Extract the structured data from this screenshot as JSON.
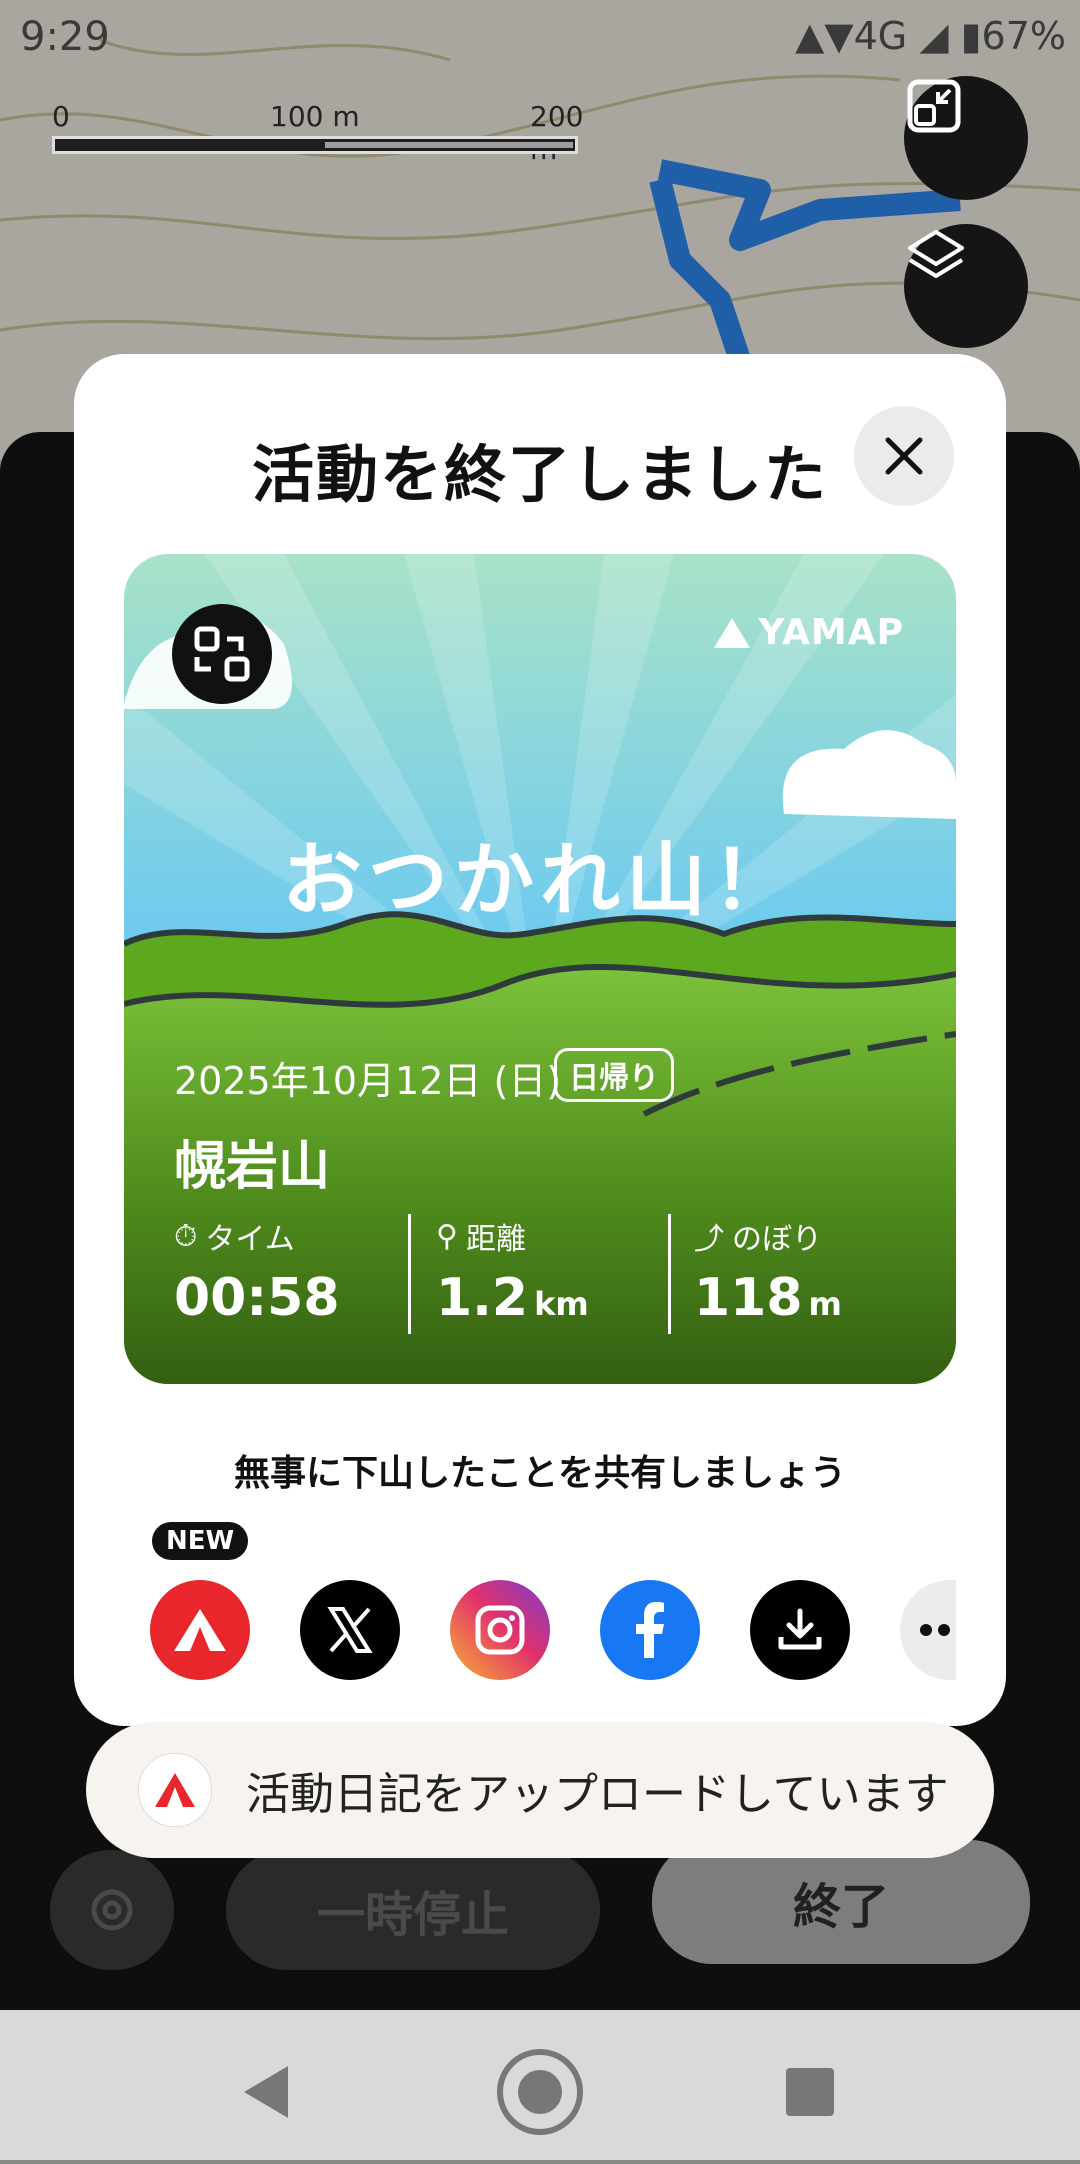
{
  "status_bar": {
    "time": "9:29",
    "network": "4G",
    "battery": "67%"
  },
  "map": {
    "scale_labels": [
      "0",
      "100 m",
      "200 m"
    ],
    "buttons": [
      "fit-route-icon",
      "layers-icon"
    ]
  },
  "modal": {
    "title": "活動を終了しました",
    "card": {
      "brand": "YAMAP",
      "headline": "おつかれ山！",
      "date": "2025年10月12日 (日)",
      "trip_type": "日帰り",
      "mountain": "幌岩山",
      "stats": [
        {
          "label": "タイム",
          "value": "00:58",
          "unit": ""
        },
        {
          "label": "距離",
          "value": "1.2",
          "unit": "km"
        },
        {
          "label": "のぼり",
          "value": "118",
          "unit": "m"
        }
      ]
    },
    "share_message": "無事に下山したことを共有しましょう",
    "new_badge": "NEW",
    "share_targets": [
      "yamap-icon",
      "x-icon",
      "instagram-icon",
      "facebook-icon",
      "download-icon",
      "more-icon"
    ]
  },
  "toast": {
    "text": "活動日記をアップロードしています"
  },
  "bottom_controls": {
    "pause_label": "一時停止",
    "stop_label": "終了"
  },
  "colors": {
    "yamap_red": "#e8262b",
    "facebook_blue": "#1877f2",
    "route_blue": "#1f5fa8",
    "card_sky": "#7fd0ef",
    "card_grass": "#4f8c1c"
  }
}
